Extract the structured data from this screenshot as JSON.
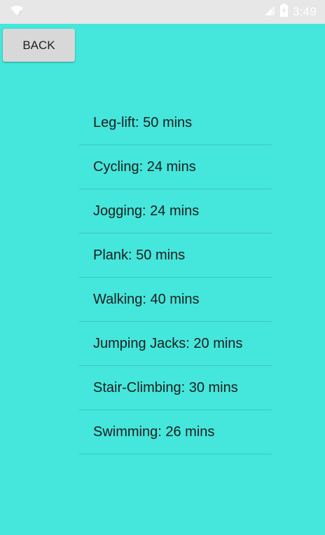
{
  "colors": {
    "background": "#45e6db",
    "status_bar": "#e7e7e7",
    "button_bg": "#d8d8d8",
    "text": "#1e1e1e"
  },
  "status_bar": {
    "time": "3:49",
    "icons": [
      "wifi-question-icon",
      "signal-icon",
      "battery-charging-icon"
    ]
  },
  "toolbar": {
    "back_label": "BACK"
  },
  "exercises": [
    "Leg-lift: 50 mins",
    "Cycling: 24 mins",
    "Jogging: 24 mins",
    "Plank: 50 mins",
    "Walking: 40 mins",
    "Jumping Jacks: 20 mins",
    "Stair-Climbing: 30 mins",
    "Swimming: 26 mins"
  ]
}
